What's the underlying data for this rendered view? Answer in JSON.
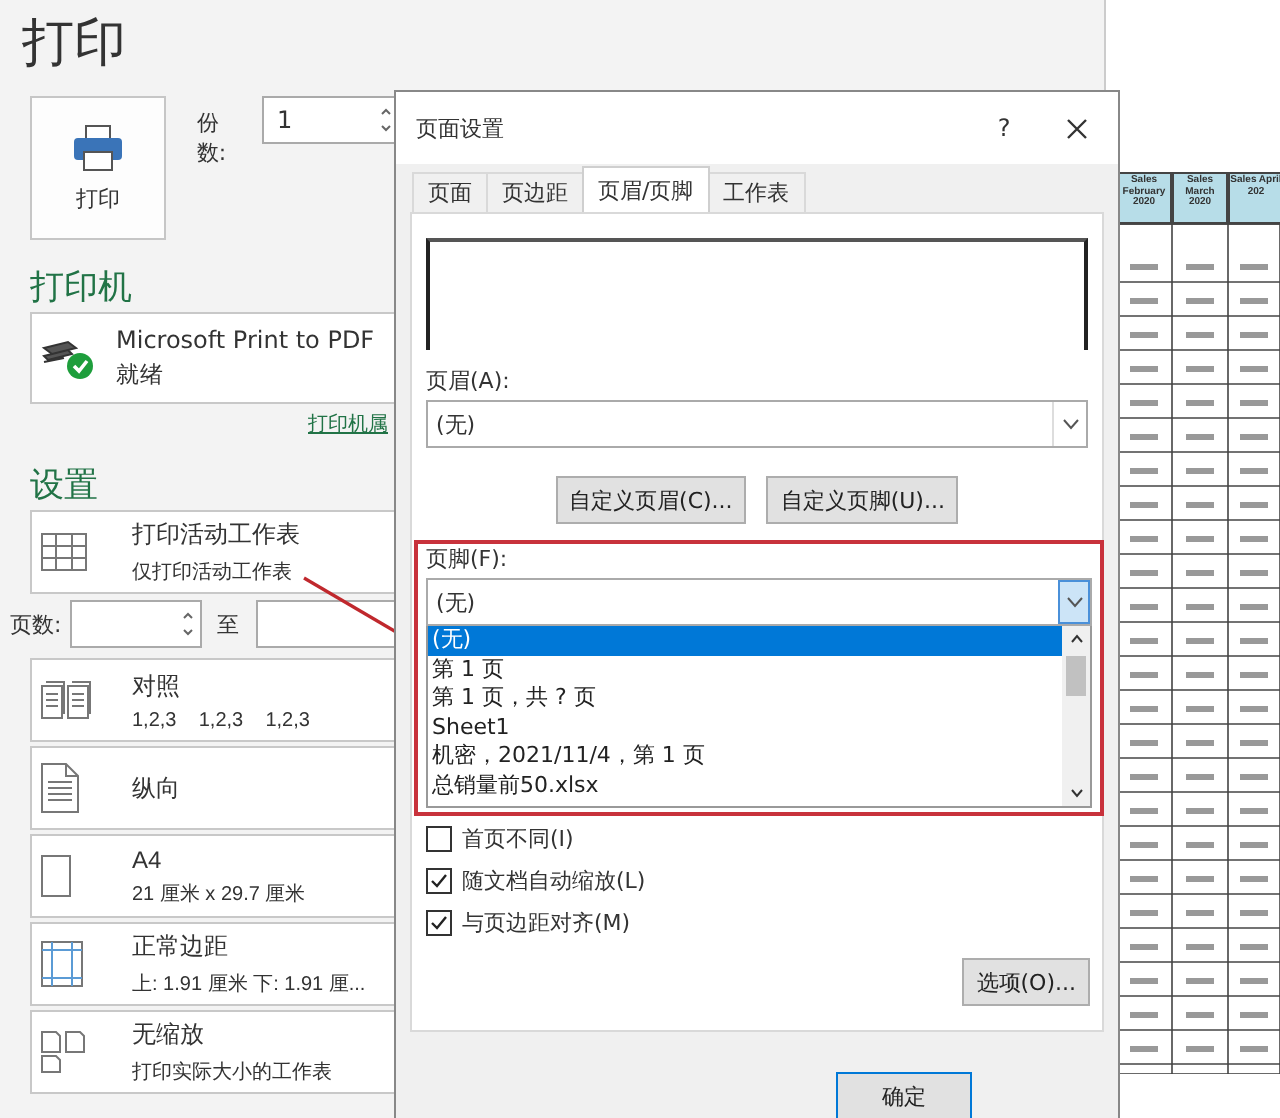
{
  "page_title": "打印",
  "print_button": {
    "label": "打印"
  },
  "copies": {
    "label": "份数:",
    "value": "1"
  },
  "printer": {
    "heading": "打印机",
    "name": "Microsoft Print to PDF",
    "status": "就绪",
    "properties_link": "打印机属"
  },
  "settings": {
    "heading": "设置",
    "scope": {
      "kind": "sheet",
      "title": "打印活动工作表",
      "subtitle": "仅打印活动工作表"
    },
    "pages": {
      "label": "页数:",
      "to": "至"
    },
    "options": [
      {
        "kind": "collate",
        "title": "对照",
        "subtitle": "1,2,3    1,2,3    1,2,3"
      },
      {
        "kind": "portrait",
        "title": "纵向"
      },
      {
        "kind": "paper",
        "title": "A4",
        "subtitle": "21 厘米 x 29.7 厘米"
      },
      {
        "kind": "margins",
        "title": "正常边距",
        "subtitle": "上: 1.91 厘米 下: 1.91 厘..."
      },
      {
        "kind": "scaling",
        "title": "无缩放",
        "subtitle": "打印实际大小的工作表"
      }
    ]
  },
  "preview": {
    "columns": [
      "Sales February 2020",
      "Sales March 2020",
      "Sales April 202"
    ]
  },
  "dialog": {
    "title": "页面设置",
    "help": "?",
    "tabs": [
      {
        "label": "页面",
        "selected": false
      },
      {
        "label": "页边距",
        "selected": false
      },
      {
        "label": "页眉/页脚",
        "selected": true
      },
      {
        "label": "工作表",
        "selected": false
      }
    ],
    "header_label": "页眉(A):",
    "header_value": "(无)",
    "buttons": [
      "自定义页眉(C)...",
      "自定义页脚(U)..."
    ],
    "footer_label": "页脚(F):",
    "footer_value": "(无)",
    "footer_options": [
      {
        "label": "(无)",
        "selected": true
      },
      {
        "label": "第 1 页",
        "selected": false
      },
      {
        "label": "第 1 页，共 ? 页",
        "selected": false
      },
      {
        "label": "Sheet1",
        "selected": false
      },
      {
        "label": "机密，2021/11/4，第 1 页",
        "selected": false
      },
      {
        "label": "总销量前50.xlsx",
        "selected": false
      }
    ],
    "checkboxes": [
      {
        "label": "首页不同(I)",
        "checked": false
      },
      {
        "label": "随文档自动缩放(L)",
        "checked": true
      },
      {
        "label": "与页边距对齐(M)",
        "checked": true
      }
    ],
    "options_button": "选项(O)...",
    "ok_button": "确定"
  }
}
